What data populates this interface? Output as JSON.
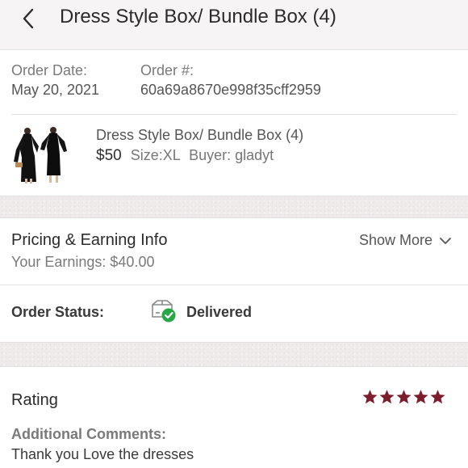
{
  "header": {
    "title": "Dress Style Box/ Bundle Box (4)",
    "back_icon": "chevron-left-icon"
  },
  "order": {
    "date_label": "Order Date:",
    "date_value": "May 20, 2021",
    "number_label": "Order #:",
    "number_value": "60a69a8670e998f35cff2959"
  },
  "item": {
    "title": "Dress Style Box/ Bundle Box (4)",
    "price": "$50",
    "size": "Size:XL",
    "buyer": "Buyer: gladyt",
    "thumbnail": "black dresses product photo"
  },
  "pricing": {
    "title": "Pricing & Earning Info",
    "earnings": "Your Earnings: $40.00",
    "show_more": "Show More"
  },
  "status": {
    "label": "Order Status:",
    "value": "Delivered",
    "icon": "delivered-box-icon",
    "check_color": "#27a844"
  },
  "rating": {
    "title": "Rating",
    "stars": 5,
    "max_stars": 5,
    "star_color": "#7d1d2c",
    "comments_label": "Additional Comments:",
    "comment": "Thank you Love the dresses"
  }
}
